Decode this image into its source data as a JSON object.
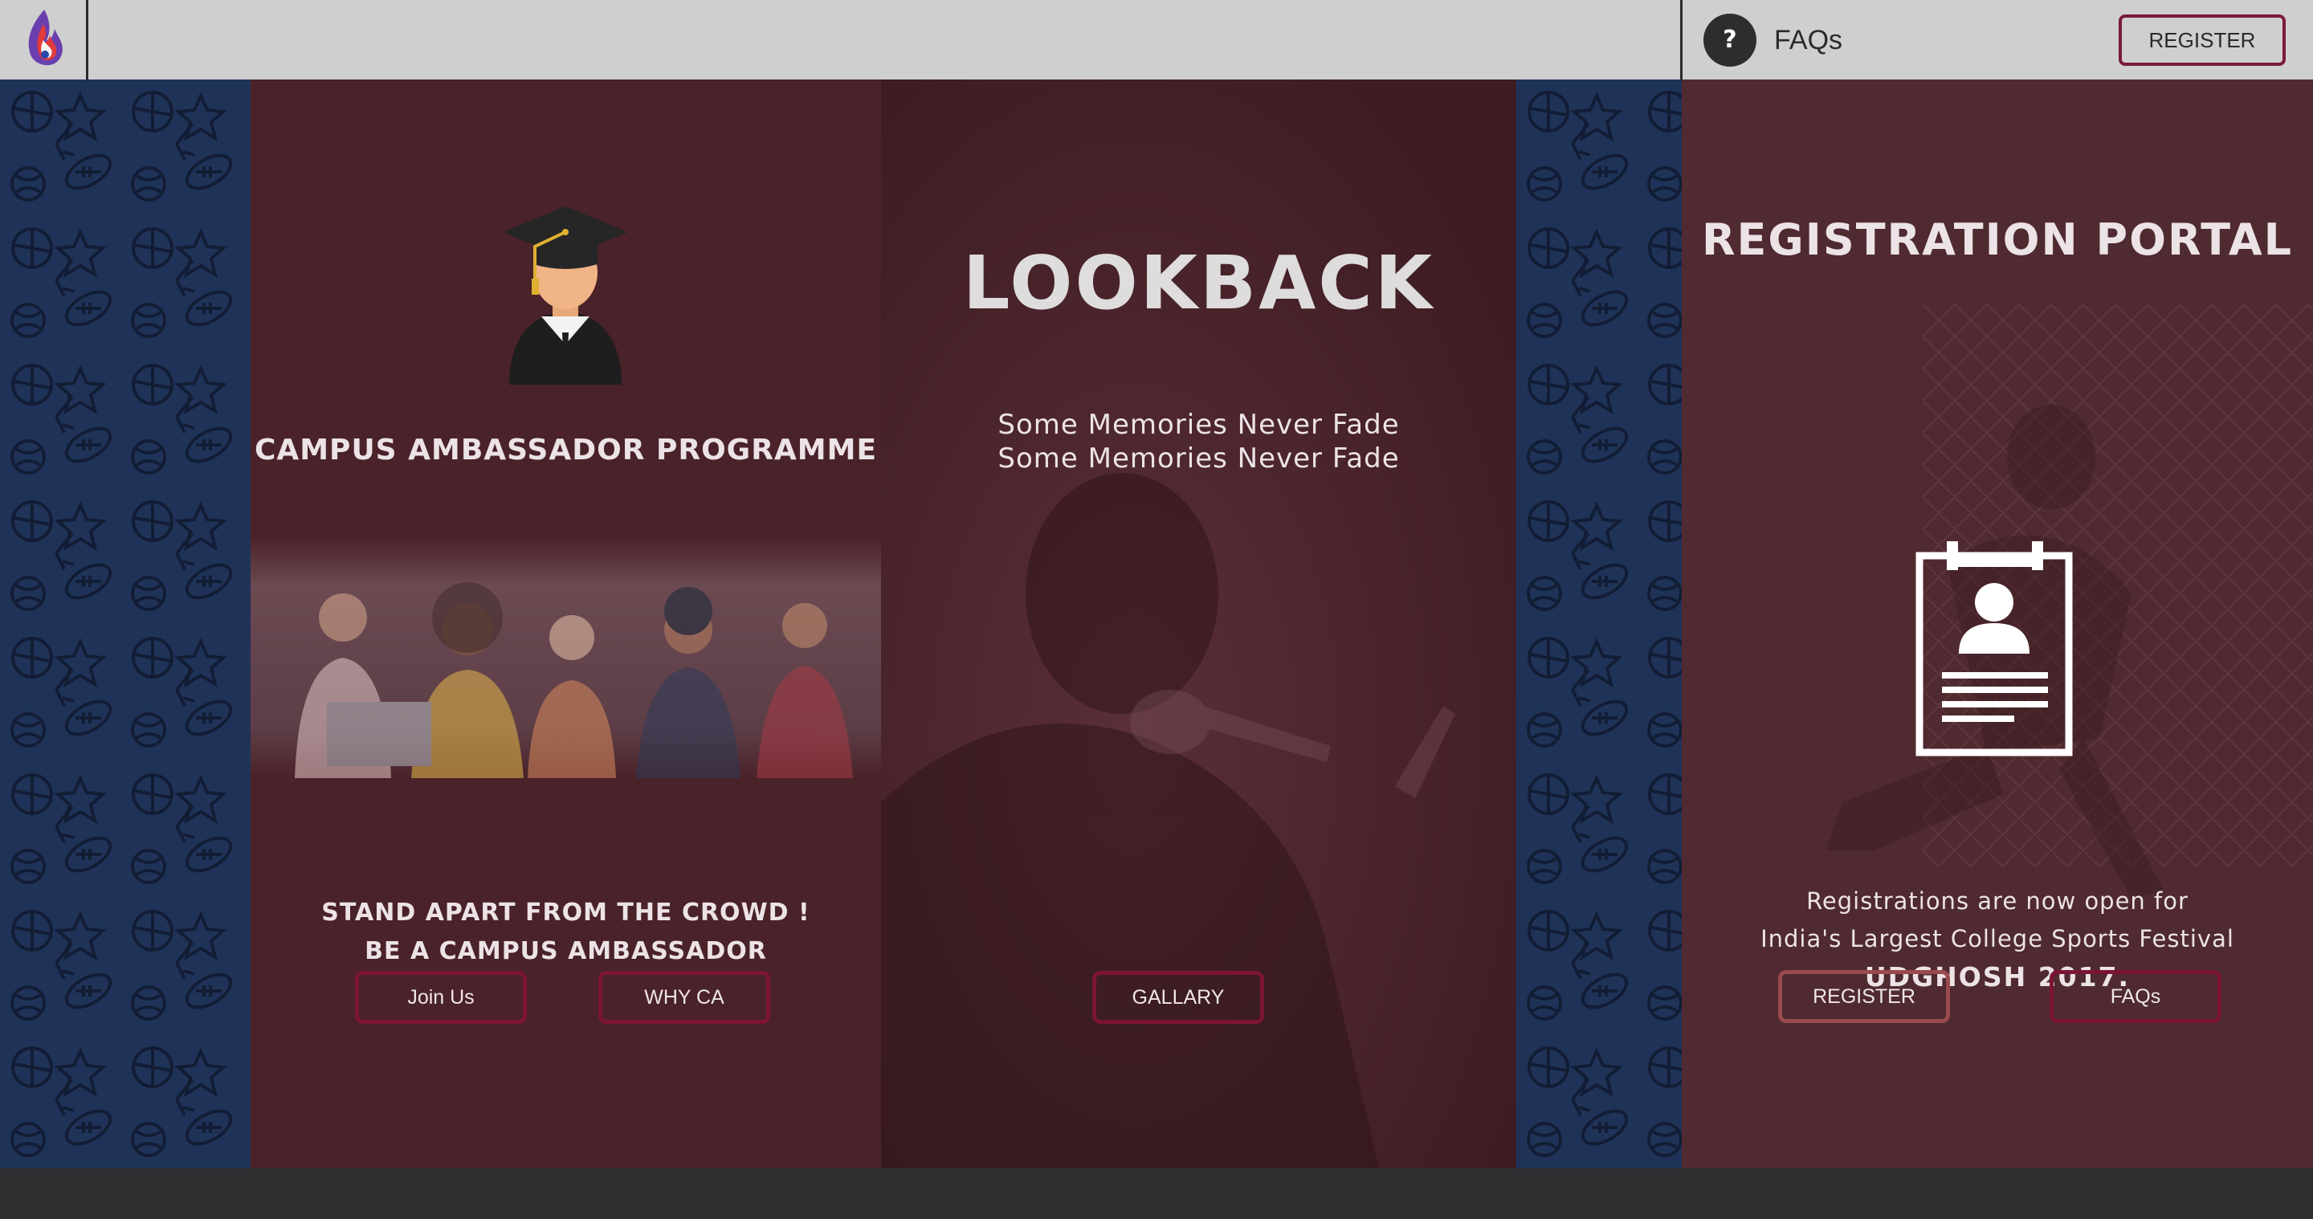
{
  "header": {
    "help_symbol": "?",
    "faq_label": "FAQs",
    "register_label": "REGISTER"
  },
  "campus": {
    "title": "CAMPUS AMBASSADOR PROGRAMME",
    "tagline_1": "STAND APART FROM THE CROWD !",
    "tagline_2": "BE A CAMPUS AMBASSADOR",
    "join_label": "Join Us",
    "why_label": "WHY CA"
  },
  "lookback": {
    "title": "LOOKBACK",
    "line_1": "Some Memories Never Fade",
    "line_2": "Some Memories Never Fade",
    "gallery_label": "GALLARY"
  },
  "registration": {
    "title": "REGISTRATION PORTAL",
    "line_1": "Registrations are now open for",
    "line_2": "India's Largest College Sports Festival",
    "line_3": "UDGHOSH 2017.",
    "register_label": "REGISTER",
    "faq_label": "FAQs"
  },
  "colors": {
    "panel": "#4a2229",
    "pattern_bg": "#1f3358",
    "accent_border": "#7c1436",
    "topbar": "#cfcfcf"
  },
  "icons": [
    "logo-icon",
    "help-icon",
    "graduate-icon",
    "id-card-icon",
    "sports-pattern"
  ]
}
